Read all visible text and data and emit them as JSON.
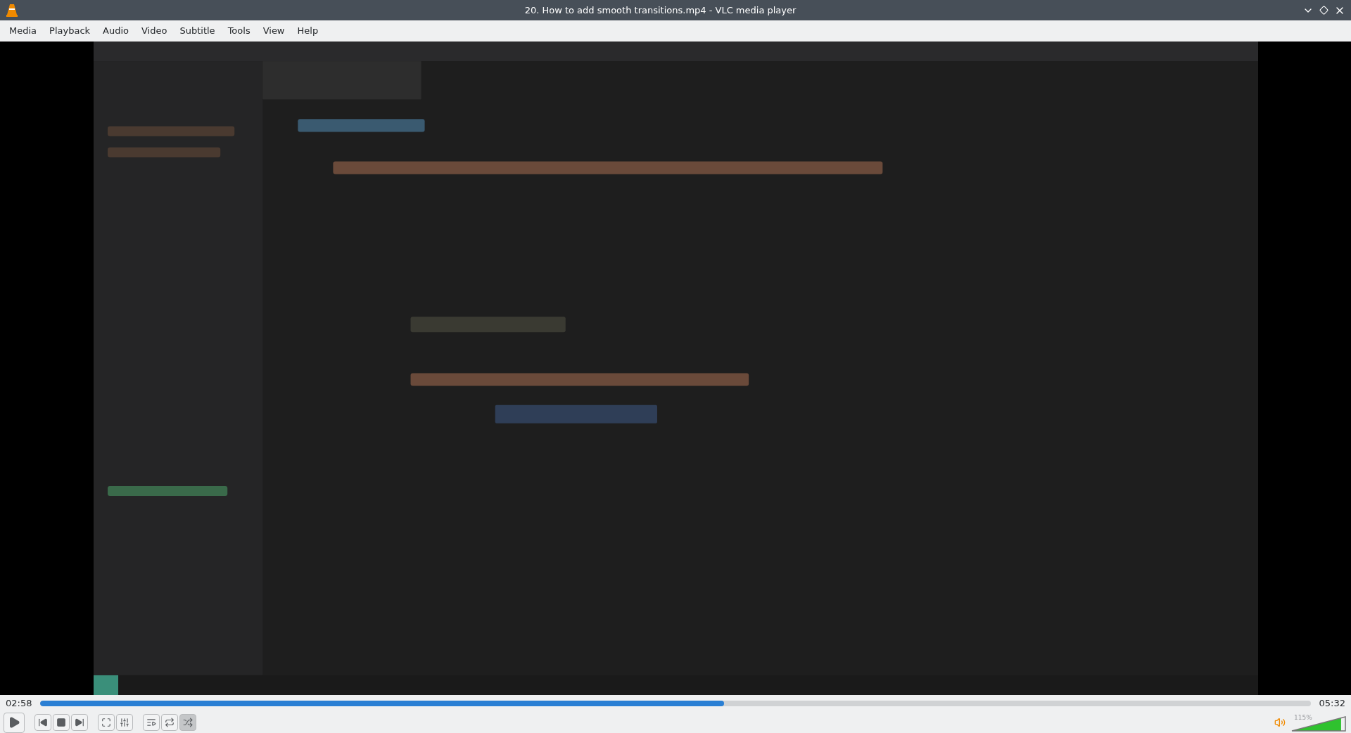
{
  "window": {
    "title": "20. How to add smooth transitions.mp4 - VLC media player"
  },
  "menu": [
    "Media",
    "Playback",
    "Audio",
    "Video",
    "Subtitle",
    "Tools",
    "View",
    "Help"
  ],
  "video": {
    "kind": "picture"
  },
  "seek": {
    "elapsed": "02:58",
    "level": 0.538,
    "total": "05:32"
  },
  "controls": [
    {
      "kind": "play",
      "on": false
    },
    {
      "kind": "prev",
      "on": false
    },
    {
      "kind": "stop",
      "on": false
    },
    {
      "kind": "next",
      "on": false
    },
    {
      "kind": "fullscreen",
      "on": false
    },
    {
      "kind": "settings",
      "on": false
    },
    {
      "kind": "playlist",
      "on": false
    },
    {
      "kind": "loop",
      "on": false
    },
    {
      "kind": "shuffle",
      "on": true
    }
  ],
  "volume": {
    "reading": "115%",
    "level": 0.92
  }
}
